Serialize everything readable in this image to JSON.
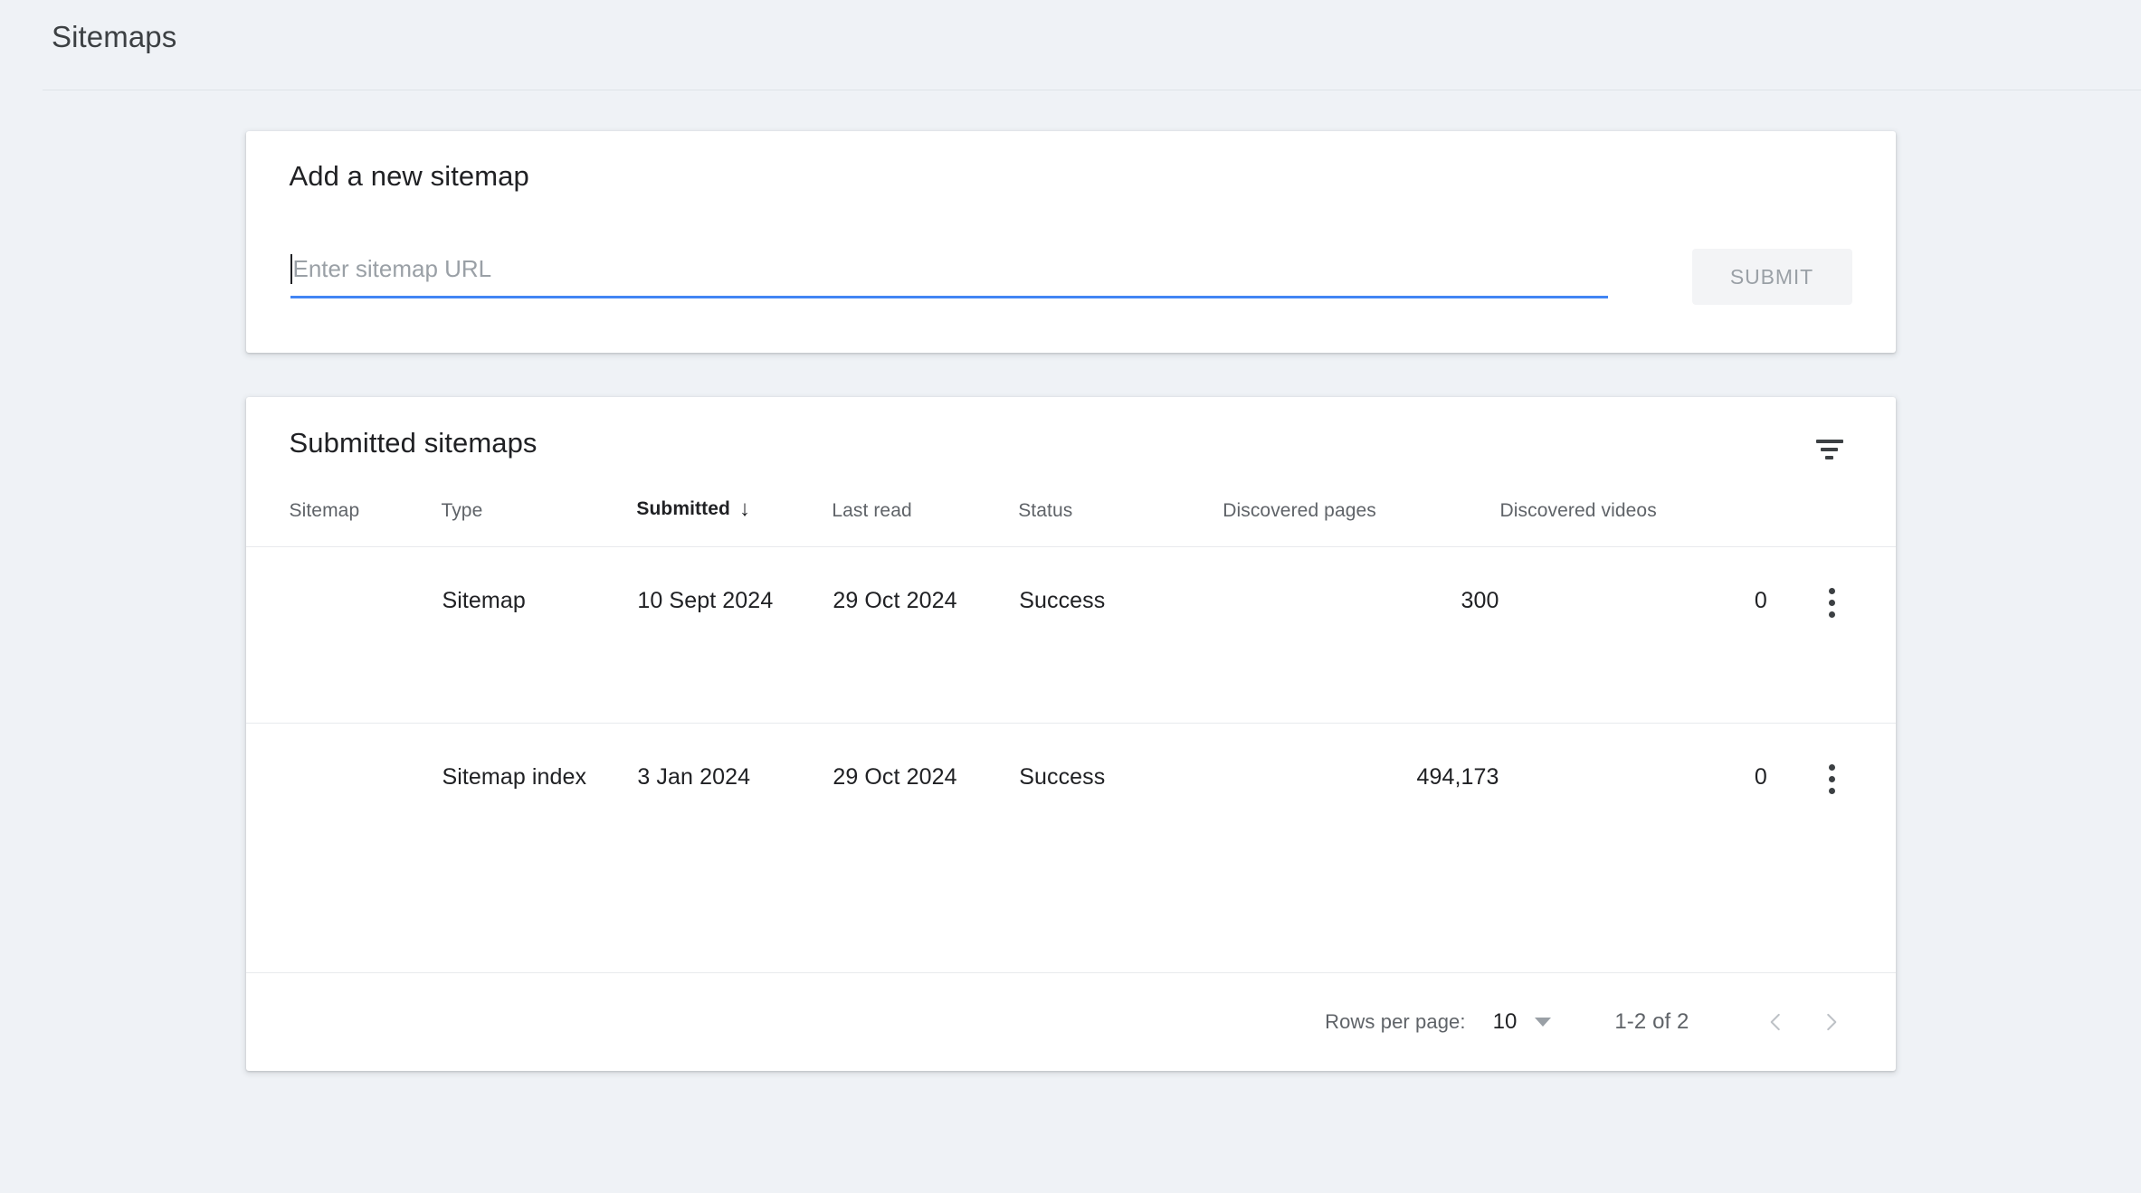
{
  "header": {
    "title": "Sitemaps"
  },
  "add_sitemap": {
    "title": "Add a new sitemap",
    "input_placeholder": "Enter sitemap URL",
    "input_value": "",
    "submit_label": "SUBMIT",
    "accent_color": "#4285f4",
    "submit_bg": "#f3f4f6",
    "submit_text_color": "#9aa0a6"
  },
  "submitted_sitemaps": {
    "title": "Submitted sitemaps",
    "filter_icon": "filter-icon",
    "columns": [
      {
        "label": "Sitemap",
        "key": "sitemap",
        "sorted": false
      },
      {
        "label": "Type",
        "key": "type",
        "sorted": false
      },
      {
        "label": "Submitted",
        "key": "submitted",
        "sorted": true,
        "sort_arrow": "↓"
      },
      {
        "label": "Last read",
        "key": "lastread",
        "sorted": false
      },
      {
        "label": "Status",
        "key": "status",
        "sorted": false
      },
      {
        "label": "Discovered pages",
        "key": "pages",
        "sorted": false
      },
      {
        "label": "Discovered videos",
        "key": "videos",
        "sorted": false
      }
    ],
    "rows": [
      {
        "sitemap": "",
        "type": "Sitemap",
        "submitted": "10 Sept 2024",
        "lastread": "29 Oct 2024",
        "status": "Success",
        "status_color": "#188038",
        "pages": "300",
        "videos": "0",
        "menu_icon": "more-vert-icon"
      },
      {
        "sitemap": "",
        "type": "Sitemap index",
        "submitted": "3 Jan 2024",
        "lastread": "29 Oct 2024",
        "status": "Success",
        "status_color": "#188038",
        "pages": "494,173",
        "videos": "0",
        "menu_icon": "more-vert-icon"
      }
    ],
    "paginator": {
      "rows_per_page_label": "Rows per page:",
      "rows_per_page_value": "10",
      "range_label": "1-2 of 2",
      "prev_icon": "chevron-left-icon",
      "next_icon": "chevron-right-icon",
      "prev_enabled": false,
      "next_enabled": false
    }
  }
}
